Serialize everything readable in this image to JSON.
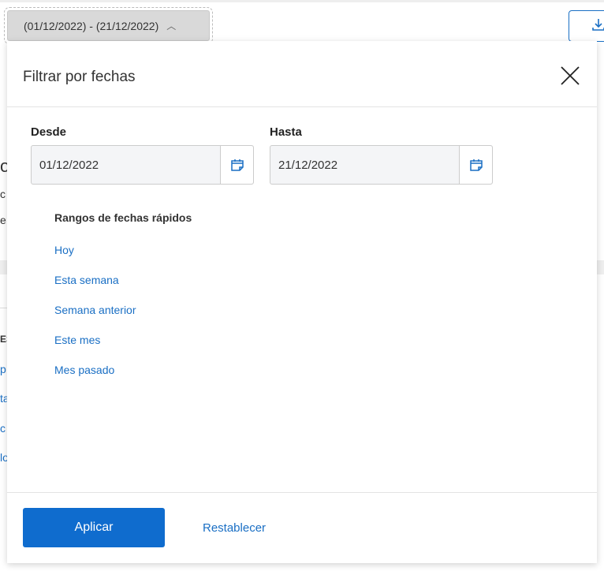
{
  "header": {
    "date_range": "(01/12/2022) - (21/12/2022)"
  },
  "background_fragments": [
    "oS",
    "c",
    "e",
    "ES",
    "p",
    "ta",
    "c",
    "lo"
  ],
  "dialog": {
    "title": "Filtrar por fechas",
    "from": {
      "label": "Desde",
      "value": "01/12/2022"
    },
    "to": {
      "label": "Hasta",
      "value": "21/12/2022"
    },
    "quick_ranges_title": "Rangos de fechas rápidos",
    "quick_ranges": [
      "Hoy",
      "Esta semana",
      "Semana anterior",
      "Este mes",
      "Mes pasado"
    ],
    "apply_label": "Aplicar",
    "reset_label": "Restablecer"
  },
  "colors": {
    "accent": "#0f6cce",
    "link": "#1a6fc4"
  }
}
